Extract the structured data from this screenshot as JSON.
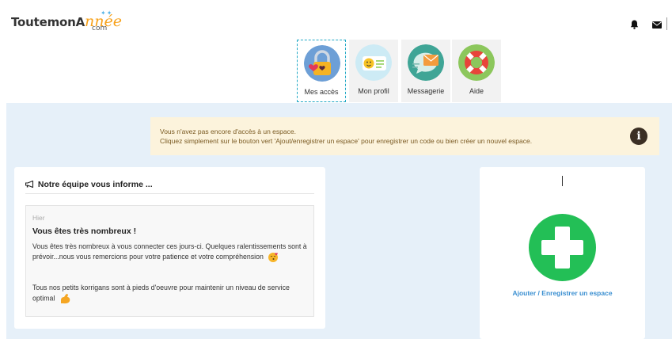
{
  "header": {
    "logo_part1": "ToutemonA",
    "logo_part2": "nnée",
    "logo_com": "com",
    "bell_icon": "bell-icon",
    "mail_icon": "envelope-icon"
  },
  "nav": {
    "items": [
      {
        "label": "Mes accès",
        "icon": "padlock-hearts-icon",
        "active": true
      },
      {
        "label": "Mon profil",
        "icon": "profile-card-icon",
        "active": false
      },
      {
        "label": "Messagerie",
        "icon": "envelope-bubble-icon",
        "active": false
      },
      {
        "label": "Aide",
        "icon": "lifebuoy-icon",
        "active": false
      }
    ]
  },
  "alert": {
    "line1": "Vous n'avez pas encore d'accès à un espace.",
    "line2": "Cliquez simplement sur le bouton vert 'Ajout/enregistrer un espace' pour enregistrer un code ou bien créer un nouvel espace.",
    "icon": "info-icon",
    "icon_text": "i"
  },
  "news": {
    "heading": "Notre équipe vous informe ...",
    "heading_icon": "megaphone-icon",
    "date": "Hier",
    "title": "Vous êtes très nombreux !",
    "p1": "Vous êtes très nombreux à vous connecter ces jours-ci. Quelques ralentissements sont à prévoir...nous vous remercions pour votre patience et votre compréhension",
    "p2": "Tous nos petits korrigans sont à pieds d'oeuvre pour maintenir un niveau de service optimal"
  },
  "add_space": {
    "label": "Ajouter / Enregistrer un espace",
    "icon": "plus-icon"
  },
  "colors": {
    "accent_green": "#23bf56",
    "link_blue": "#3a8fd1",
    "alert_bg": "#fcf3dc",
    "main_bg": "#e6f0f9"
  }
}
